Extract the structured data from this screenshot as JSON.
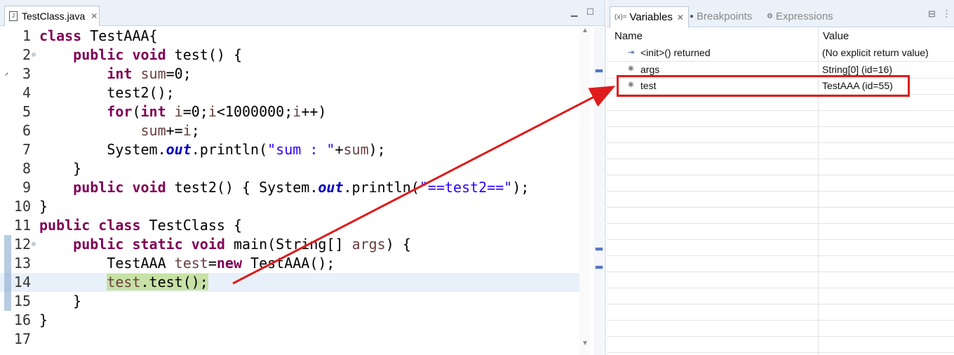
{
  "editor": {
    "tab_label": "TestClass.java",
    "tab_close": "✕",
    "lines": [
      {
        "num": "1"
      },
      {
        "num": "2"
      },
      {
        "num": "3"
      },
      {
        "num": "4"
      },
      {
        "num": "5"
      },
      {
        "num": "6"
      },
      {
        "num": "7"
      },
      {
        "num": "8"
      },
      {
        "num": "9"
      },
      {
        "num": "10"
      },
      {
        "num": "11"
      },
      {
        "num": "12"
      },
      {
        "num": "13"
      },
      {
        "num": "14"
      },
      {
        "num": "15"
      },
      {
        "num": "16"
      },
      {
        "num": "17"
      }
    ],
    "current_line": 14
  },
  "variables_view": {
    "tabs": {
      "variables": "Variables",
      "breakpoints": "Breakpoints",
      "expressions": "Expressions"
    },
    "variables_tab_icon": "(x)=",
    "columns": {
      "name": "Name",
      "value": "Value"
    },
    "rows": [
      {
        "name": "<init>() returned",
        "value": "(No explicit return value)",
        "icon": "return-value-icon"
      },
      {
        "name": "args",
        "value": "String[0]  (id=16)",
        "icon": "local-variable-icon"
      },
      {
        "name": "test",
        "value": "TestAAA  (id=55)",
        "icon": "local-variable-icon"
      }
    ]
  },
  "annotation": {
    "color": "#e01b1b",
    "target_row": "test"
  },
  "colors": {
    "keyword": "#7f0055",
    "string": "#2a00ff",
    "field": "#0000c0",
    "highlight": "#c7e1a6",
    "current_line": "#e8f0fa"
  }
}
